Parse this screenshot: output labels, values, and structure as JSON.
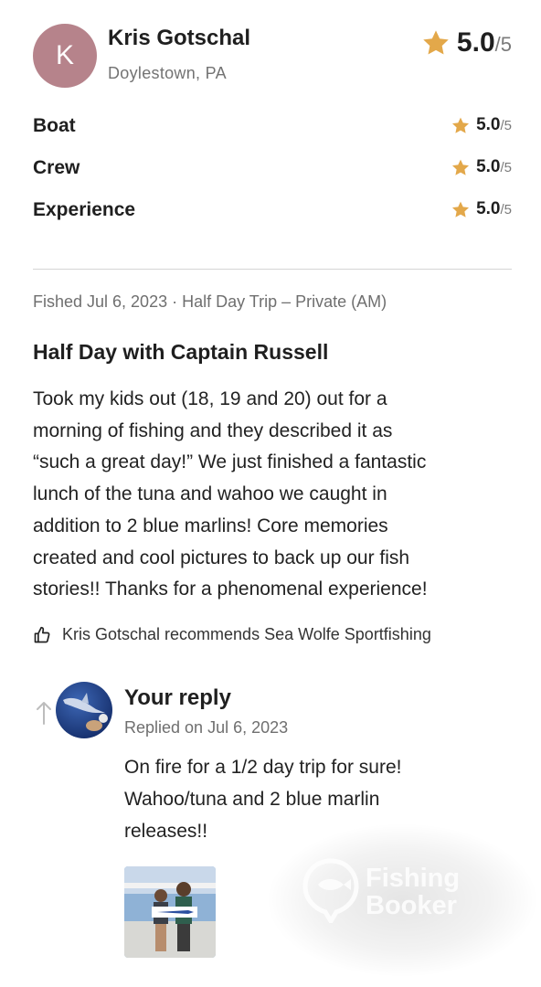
{
  "reviewer": {
    "initial": "K",
    "avatar_color": "#b6838b",
    "name": "Kris Gotschal",
    "location": "Doylestown, PA"
  },
  "overall_rating": {
    "score": "5.0",
    "out_of": "/5",
    "icon": "star-icon",
    "color": "#e3a84a"
  },
  "category_ratings": [
    {
      "label": "Boat",
      "score": "5.0",
      "out_of": "/5"
    },
    {
      "label": "Crew",
      "score": "5.0",
      "out_of": "/5"
    },
    {
      "label": "Experience",
      "score": "5.0",
      "out_of": "/5"
    }
  ],
  "review": {
    "meta": "Fished Jul 6, 2023 · Half Day Trip – Private (AM)",
    "title": "Half Day with Captain Russell",
    "lines": [
      "Took my kids out (18, 19 and 20) out for a",
      "morning of fishing and they described it as",
      "“such a great day!” We just finished a fantastic",
      "lunch of the tuna and wahoo we caught in",
      "addition to 2 blue marlins! Core memories",
      "created and cool pictures to back up our fish",
      "stories!! Thanks for a phenomenal experience!"
    ],
    "recommendation": "Kris Gotschal recommends Sea Wolfe Sportfishing",
    "recommend_icon": "thumbs-up-icon"
  },
  "reply": {
    "icon": "reply-arrow-icon",
    "title": "Your reply",
    "date": "Replied on Jul 6, 2023",
    "lines": [
      "On fire for a 1/2 day trip for sure!",
      "Wahoo/tuna and 2 blue marlin",
      "releases!!"
    ],
    "photo_icon": "fishing-photo-thumbnail"
  },
  "watermark": {
    "line1": "Fishing",
    "line2": "Booker"
  }
}
